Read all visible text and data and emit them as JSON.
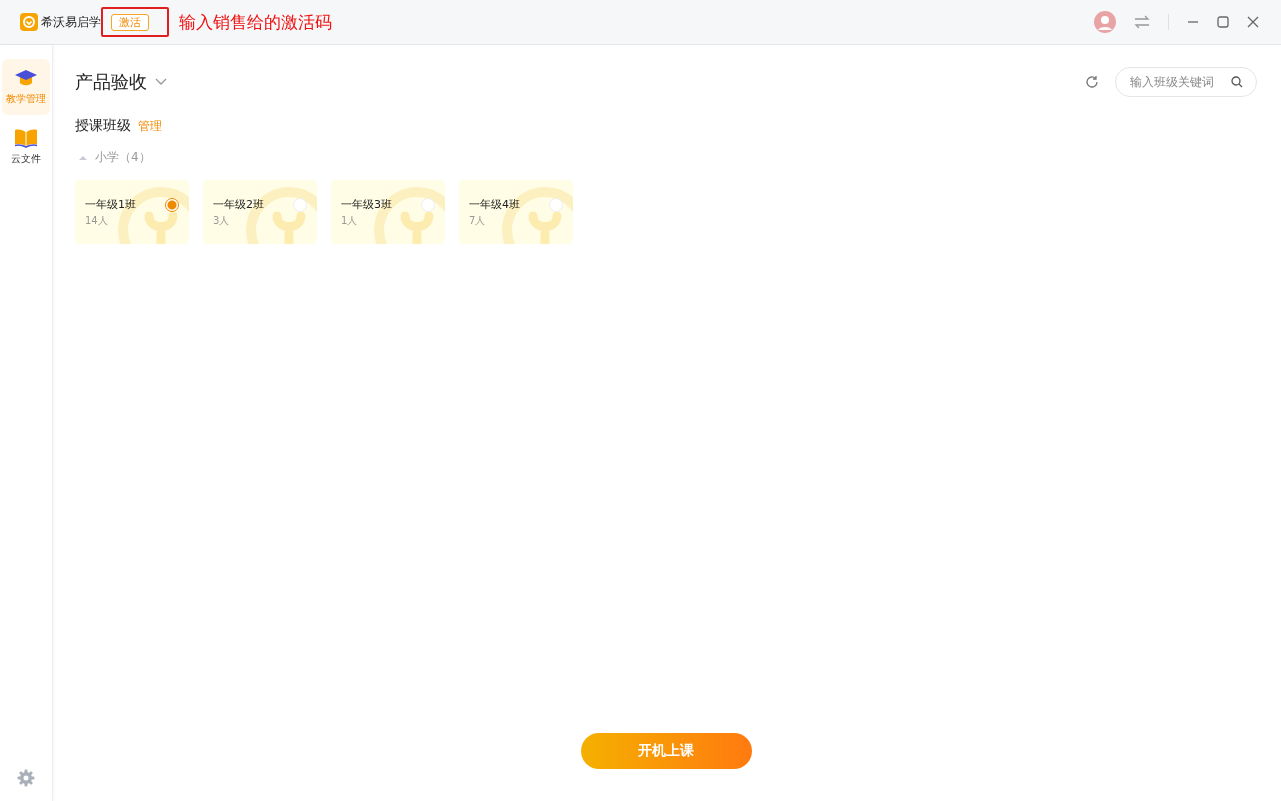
{
  "app": {
    "name": "希沃易启学",
    "activate_button": "激活"
  },
  "annotation": {
    "text": "输入销售给的激活码"
  },
  "sidebar": {
    "items": [
      {
        "kind": "teach",
        "label": "教学管理",
        "selected": true
      },
      {
        "kind": "files",
        "label": "云文件",
        "selected": false
      }
    ]
  },
  "header": {
    "title": "产品验收",
    "search": {
      "placeholder": "输入班级关键词"
    }
  },
  "section": {
    "title": "授课班级",
    "action": "管理"
  },
  "groups": [
    {
      "label": "小学（4）",
      "expanded": true,
      "classes": [
        {
          "name": "一年级1班",
          "count": "14人",
          "selected": true
        },
        {
          "name": "一年级2班",
          "count": "3人",
          "selected": false
        },
        {
          "name": "一年级3班",
          "count": "1人",
          "selected": false
        },
        {
          "name": "一年级4班",
          "count": "7人",
          "selected": false
        }
      ]
    }
  ],
  "start_button": "开机上课"
}
